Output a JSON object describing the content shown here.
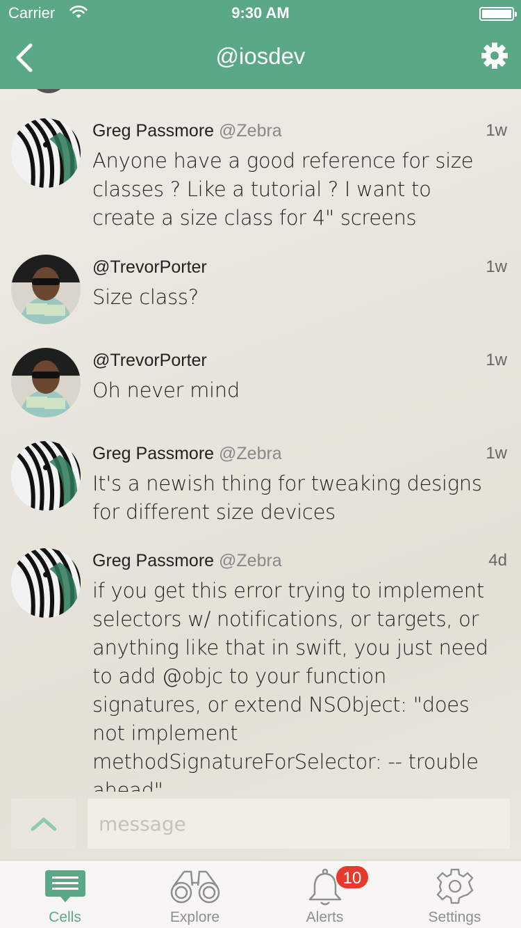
{
  "status_bar": {
    "carrier": "Carrier",
    "time": "9:30 AM"
  },
  "nav": {
    "title": "@iosdev"
  },
  "messages": [
    {
      "name": "Greg Passmore",
      "handle": "@Zebra",
      "time": "1w",
      "avatar": "zebra",
      "body": "Anyone have a good reference for size classes ? Like a tutorial ? I want to create a size class for 4\" screens"
    },
    {
      "name": "@TrevorPorter",
      "handle": "",
      "time": "1w",
      "avatar": "person",
      "body": "Size class?"
    },
    {
      "name": "@TrevorPorter",
      "handle": "",
      "time": "1w",
      "avatar": "person",
      "body": "Oh never mind"
    },
    {
      "name": "Greg Passmore",
      "handle": "@Zebra",
      "time": "1w",
      "avatar": "zebra",
      "body": "It's a newish thing for tweaking designs for different size devices"
    },
    {
      "name": "Greg Passmore",
      "handle": "@Zebra",
      "time": "4d",
      "avatar": "zebra",
      "body": "if you get this error trying to implement selectors w/ notifications, or targets, or anything like that in swift, you just need to add @objc to your function signatures, or extend NSObject: \"does not implement methodSignatureForSelector: -- trouble ahead\""
    }
  ],
  "compose": {
    "placeholder": "message",
    "value": ""
  },
  "tabs": [
    {
      "label": "Cells",
      "icon": "chat-bubble-icon",
      "active": true
    },
    {
      "label": "Explore",
      "icon": "binoculars-icon",
      "active": false
    },
    {
      "label": "Alerts",
      "icon": "bell-icon",
      "active": false,
      "badge": "10"
    },
    {
      "label": "Settings",
      "icon": "gear-icon",
      "active": false
    }
  ],
  "colors": {
    "accent": "#5aa886",
    "badge": "#e8392d",
    "background": "#ebe8e0"
  }
}
